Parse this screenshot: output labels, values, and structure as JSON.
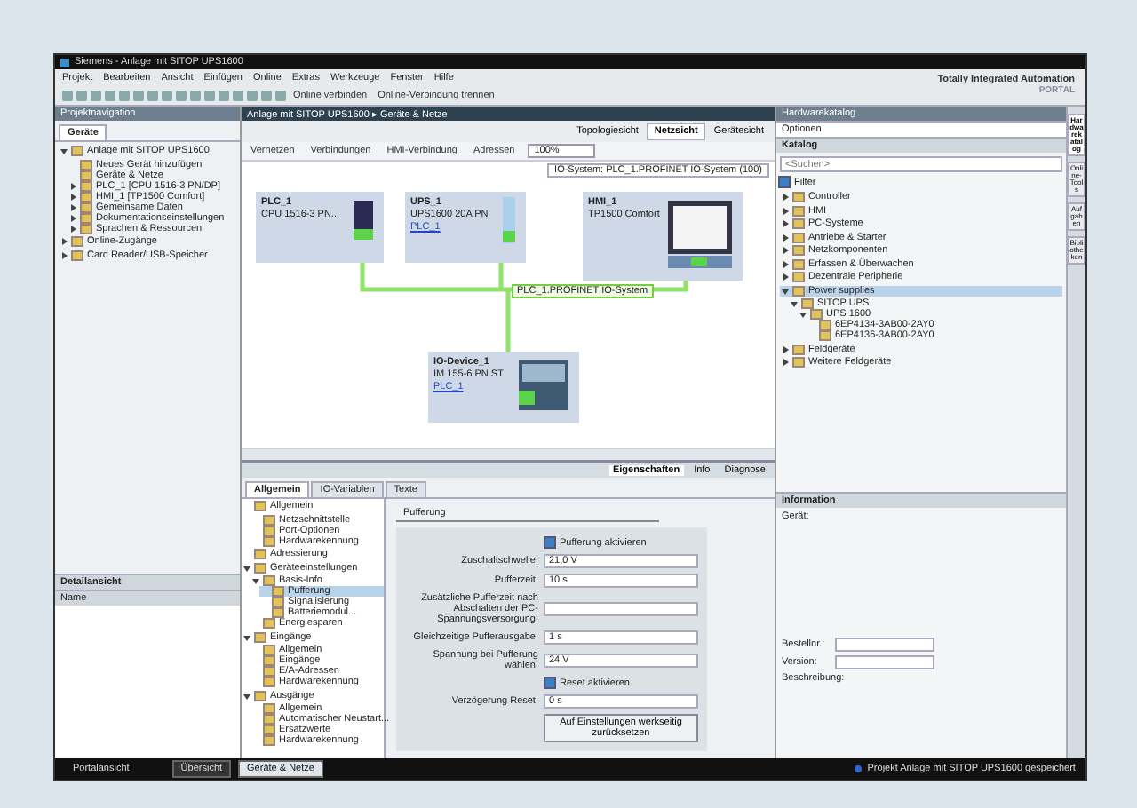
{
  "window": {
    "title": "Siemens - Anlage mit SITOP UPS1600"
  },
  "menu": [
    "Projekt",
    "Bearbeiten",
    "Ansicht",
    "Einfügen",
    "Online",
    "Extras",
    "Werkzeuge",
    "Fenster",
    "Hilfe"
  ],
  "toolbar": {
    "buttons": [
      "Online verbinden",
      "Online-Verbindung trennen"
    ]
  },
  "brand": {
    "line1": "Totally Integrated Automation",
    "line2": "PORTAL"
  },
  "project_nav": {
    "title": "Projektnavigation",
    "tab": "Geräte",
    "tree": [
      {
        "label": "Anlage mit SITOP UPS1600",
        "expanded": true,
        "children": [
          {
            "label": "Neues Gerät hinzufügen"
          },
          {
            "label": "Geräte & Netze"
          },
          {
            "label": "PLC_1 [CPU 1516-3 PN/DP]",
            "expanded": false
          },
          {
            "label": "HMI_1 [TP1500 Comfort]",
            "expanded": false
          },
          {
            "label": "Gemeinsame Daten",
            "expanded": false
          },
          {
            "label": "Dokumentationseinstellungen",
            "expanded": false
          },
          {
            "label": "Sprachen & Ressourcen",
            "expanded": false
          }
        ]
      },
      {
        "label": "Online-Zugänge",
        "expanded": false
      },
      {
        "label": "Card Reader/USB-Speicher",
        "expanded": false
      }
    ],
    "detail_title": "Detailansicht",
    "detail_column": "Name"
  },
  "editor": {
    "title": "Anlage mit SITOP UPS1600 ▸ Geräte & Netze",
    "views": [
      {
        "label": "Topologiesicht",
        "selected": false
      },
      {
        "label": "Netzsicht",
        "selected": true
      },
      {
        "label": "Gerätesicht",
        "selected": false
      }
    ],
    "tools": [
      "Vernetzen",
      "Verbindungen",
      "HMI-Verbindung",
      "Adressen"
    ],
    "zoom": "100%",
    "io_system_label": "IO-System: PLC_1.PROFINET IO-System (100)",
    "devices": [
      {
        "name": "PLC_1",
        "type": "CPU 1516-3 PN...",
        "kind": "plc"
      },
      {
        "name": "UPS_1",
        "type": "UPS1600 20A PN",
        "link": "PLC_1",
        "kind": "ups"
      },
      {
        "name": "HMI_1",
        "type": "TP1500 Comfort",
        "kind": "hmi"
      },
      {
        "name": "IO-Device_1",
        "type": "IM 155-6 PN ST",
        "link": "PLC_1",
        "kind": "io"
      }
    ],
    "network_label": "PLC_1.PROFINET IO-System"
  },
  "inspector": {
    "tabs": [
      {
        "label": "Eigenschaften",
        "selected": true
      },
      {
        "label": "Info",
        "selected": false
      },
      {
        "label": "Diagnose",
        "selected": false
      }
    ],
    "subtabs": [
      {
        "label": "Allgemein",
        "selected": true
      },
      {
        "label": "IO-Variablen",
        "selected": false
      },
      {
        "label": "Texte",
        "selected": false
      }
    ],
    "tree": [
      {
        "label": "Allgemein",
        "children": [
          {
            "label": "Netzschnittstelle"
          },
          {
            "label": "Port-Optionen"
          },
          {
            "label": "Hardwarekennung"
          }
        ]
      },
      {
        "label": "Adressierung"
      },
      {
        "label": "Geräteeinstellungen",
        "expanded": true,
        "children": [
          {
            "label": "Basis-Info",
            "expanded": true,
            "children": [
              {
                "label": "Pufferung",
                "selected": true
              },
              {
                "label": "Signalisierung"
              },
              {
                "label": "Batteriemodul..."
              }
            ]
          },
          {
            "label": "Energiesparen"
          }
        ]
      },
      {
        "label": "Eingänge",
        "expanded": true,
        "children": [
          {
            "label": "Allgemein"
          },
          {
            "label": "Eingänge"
          },
          {
            "label": "E/A-Adressen"
          },
          {
            "label": "Hardwarekennung"
          }
        ]
      },
      {
        "label": "Ausgänge",
        "expanded": true,
        "children": [
          {
            "label": "Allgemein"
          },
          {
            "label": "Automatischer Neustart..."
          },
          {
            "label": "Ersatzwerte"
          },
          {
            "label": "Hardwarekennung"
          }
        ]
      }
    ],
    "section": "Pufferung",
    "fields": [
      {
        "kind": "checkbox",
        "label": "Pufferung aktivieren",
        "checked": true
      },
      {
        "kind": "select",
        "label": "Zuschaltschwelle:",
        "value": "21,0 V"
      },
      {
        "kind": "input",
        "label": "Pufferzeit:",
        "value": "10 s"
      },
      {
        "kind": "input",
        "label": "Zusätzliche Pufferzeit nach Abschalten der PC-Spannungsversorgung:"
      },
      {
        "kind": "select",
        "label": "Gleichzeitige Pufferausgabe:",
        "value": "1 s"
      },
      {
        "kind": "select",
        "label": "Spannung bei Pufferung wählen:",
        "value": "24 V"
      },
      {
        "kind": "checkbox",
        "label": "Reset aktivieren",
        "checked": true
      },
      {
        "kind": "input",
        "label": "Verzögerung Reset:",
        "value": "0 s"
      },
      {
        "kind": "button",
        "label": "Auf Einstellungen werkseitig zurücksetzen"
      }
    ]
  },
  "catalog": {
    "title": "Hardwarekatalog",
    "options": "Optionen",
    "section": "Katalog",
    "search": {
      "placeholder": "<Suchen>"
    },
    "filter": {
      "label": "Filter",
      "checked": true
    },
    "tree": [
      {
        "label": "Controller",
        "expanded": false
      },
      {
        "label": "HMI",
        "expanded": false
      },
      {
        "label": "PC-Systeme",
        "expanded": false
      },
      {
        "label": "Antriebe & Starter",
        "expanded": false
      },
      {
        "label": "Netzkomponenten",
        "expanded": false
      },
      {
        "label": "Erfassen & Überwachen",
        "expanded": false
      },
      {
        "label": "Dezentrale Peripherie",
        "expanded": false
      },
      {
        "label": "Power supplies",
        "expanded": true,
        "selected": true,
        "children": [
          {
            "label": "SITOP UPS",
            "expanded": true,
            "children": [
              {
                "label": "UPS 1600",
                "expanded": true,
                "children": [
                  {
                    "label": "6EP4134-3AB00-2AY0"
                  },
                  {
                    "label": "6EP4136-3AB00-2AY0"
                  }
                ]
              }
            ]
          }
        ]
      },
      {
        "label": "Feldgeräte",
        "expanded": false
      },
      {
        "label": "Weitere Feldgeräte",
        "expanded": false
      }
    ],
    "info_title": "Information",
    "info_device": "Gerät:",
    "info_fields": [
      {
        "label": "Bestellnr.:"
      },
      {
        "label": "Version:"
      }
    ],
    "info_desc": "Beschreibung:"
  },
  "sidetabs": [
    {
      "label": "Hardwarekatalog",
      "selected": true
    },
    {
      "label": "Online-Tools",
      "selected": false
    },
    {
      "label": "Aufgaben",
      "selected": false
    },
    {
      "label": "Bibliotheken",
      "selected": false
    }
  ],
  "taskbar": {
    "portal": "Portalansicht",
    "items": [
      {
        "label": "Übersicht",
        "selected": false
      },
      {
        "label": "Geräte & Netze",
        "selected": true
      }
    ],
    "status": "Projekt Anlage mit SITOP UPS1600 gespeichert."
  }
}
